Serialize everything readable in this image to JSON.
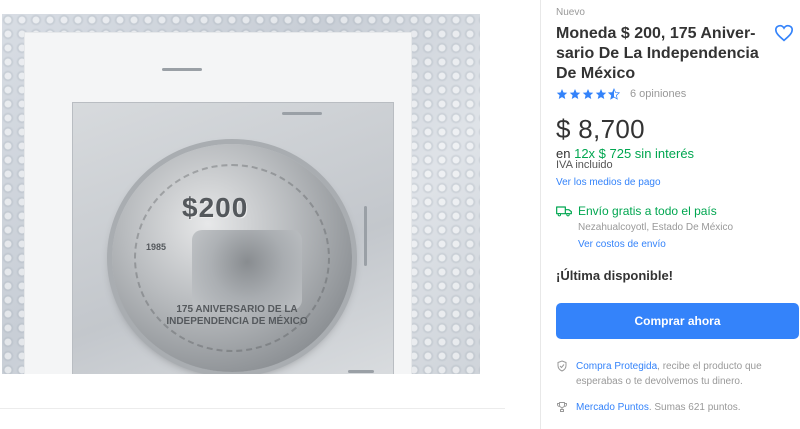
{
  "product": {
    "condition": "Nuevo",
    "title": "Moneda $ 200, 175 Aniver-sario De La Independencia De México",
    "rating": {
      "value": 4.5,
      "max": 5,
      "opinions_label": "6 opiniones"
    },
    "price": "$ 8,700",
    "installments": {
      "prefix": "en",
      "text": "12x $ 725 sin interés"
    },
    "iva": "IVA incluido",
    "payment_link": "Ver los medios de pago"
  },
  "shipping": {
    "label": "Envío gratis a todo el país",
    "location": "Nezahualcoyotl, Estado De México",
    "cost_link": "Ver costos de envío"
  },
  "stock_label": "¡Última disponible!",
  "buy_button": "Comprar ahora",
  "benefits": {
    "protect": {
      "link": "Compra Protegida",
      "text": ", recibe el producto que esperabas o te devolvemos tu dinero."
    },
    "points": {
      "link": "Mercado Puntos",
      "text": ". Sumas 621 puntos."
    }
  },
  "colors": {
    "accent": "#3483fa",
    "green": "#00a650",
    "muted": "#999999"
  },
  "icons": {
    "favorite": "heart-outline-icon",
    "star": "star-icon",
    "truck": "truck-icon",
    "shield": "shield-check-icon",
    "trophy": "trophy-icon"
  }
}
